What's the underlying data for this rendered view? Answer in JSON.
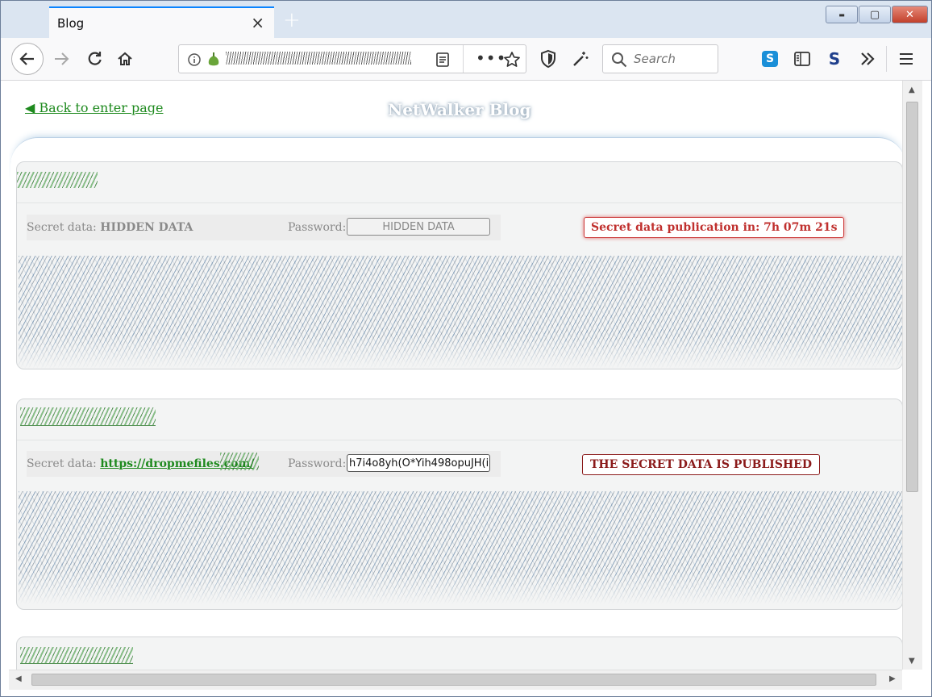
{
  "browser": {
    "tab_title": "Blog",
    "close_glyph": "×",
    "new_tab_glyph": "+",
    "window_buttons": {
      "minimize": "▬",
      "maximize": "▢",
      "close": "✕"
    },
    "search_placeholder": "Search"
  },
  "page": {
    "back_link": "◀ Back to enter page",
    "title": "NetWalker Blog"
  },
  "posts": [
    {
      "secret_label": "Secret data:",
      "secret_value": "HIDDEN DATA",
      "password_label": "Password:",
      "password_value": "HIDDEN DATA",
      "status": "Secret data publication in: 7h 07m 21s"
    },
    {
      "secret_label": "Secret data:",
      "secret_value": "https://dropmefiles.com/",
      "password_label": "Password:",
      "password_value": "h7i4o8yh(O*Yih498opuJH(i",
      "status": "THE SECRET DATA IS PUBLISHED"
    }
  ],
  "colors": {
    "link_green": "#1e8a1e",
    "status_red": "#c0302e",
    "published_dark_red": "#8b1a1a",
    "tab_accent": "#0a84ff"
  }
}
